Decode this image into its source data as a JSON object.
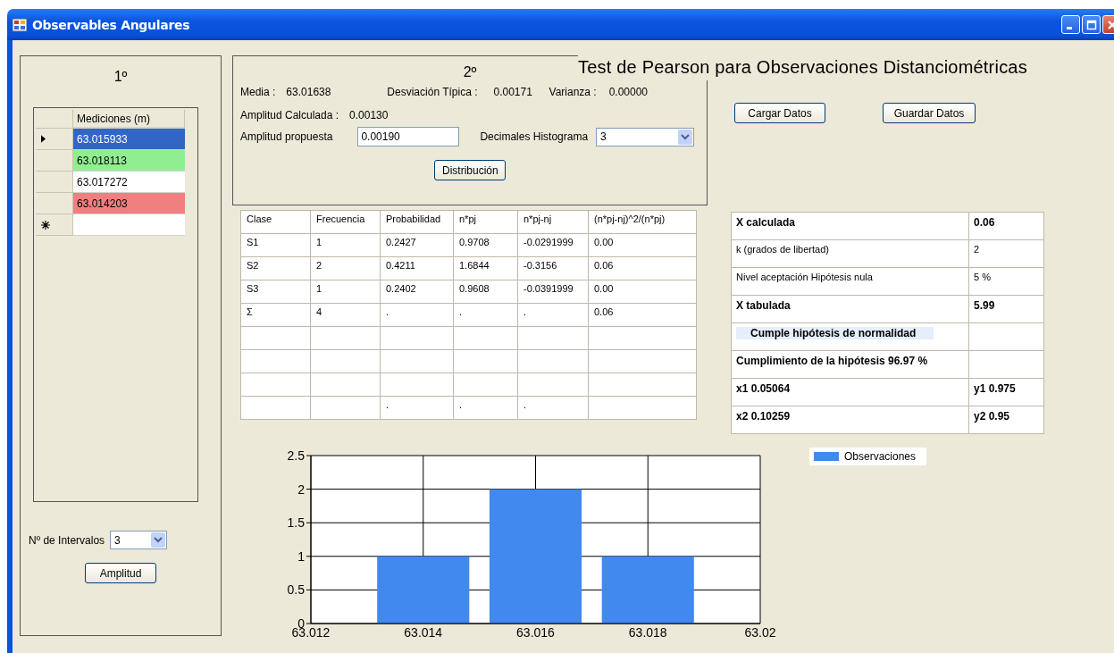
{
  "window": {
    "title": "Observables Angulares"
  },
  "panel_1": {
    "heading": "1º",
    "grid": {
      "column": "Mediciones (m)",
      "rows": [
        {
          "value": "63.015933",
          "selected": true,
          "color": "#3366c4"
        },
        {
          "value": "63.018113",
          "selected": false,
          "color": "#90ee90"
        },
        {
          "value": "63.017272",
          "selected": false,
          "color": "#ffffff"
        },
        {
          "value": "63.014203",
          "selected": false,
          "color": "#f08080"
        }
      ]
    },
    "intervals": {
      "label": "Nº de Intervalos",
      "value": "3"
    },
    "button": "Amplitud"
  },
  "panel_2": {
    "heading": "2º",
    "stats": [
      {
        "label": "Media :",
        "value": "63.01638"
      },
      {
        "label": "Desviación Típica :",
        "value": "0.00171"
      },
      {
        "label": "Varianza :",
        "value": "0.00000"
      }
    ],
    "amplitud_calculada": {
      "label": "Amplitud Calculada :",
      "value": "0.00130"
    },
    "amplitud_propuesta": {
      "label": "Amplitud propuesta",
      "value": "0.00190"
    },
    "decimales": {
      "label": "Decimales Histograma",
      "value": "3"
    },
    "button": "Distribución"
  },
  "title": "Test de Pearson para Observaciones Distanciométricas",
  "buttons": [
    "Cargar Datos",
    "Guardar Datos"
  ],
  "table": {
    "columns": [
      "Clase",
      "Frecuencia",
      "Probabilidad",
      "n*pj",
      "n*pj-nj",
      "(n*pj-nj)^2/(n*pj)"
    ],
    "rows": [
      [
        "S1",
        "1",
        "0.2427",
        "0.9708",
        "-0.0291999",
        "0.00"
      ],
      [
        "S2",
        "2",
        "0.4211",
        "1.6844",
        "-0.3156",
        "0.06"
      ],
      [
        "S3",
        "1",
        "0.2402",
        "0.9608",
        "-0.0391999",
        "0.00"
      ],
      [
        "Σ",
        "4",
        ".",
        ".",
        ".",
        "0.06"
      ],
      [
        null,
        null,
        null,
        null,
        null,
        null
      ],
      [
        null,
        null,
        null,
        null,
        null,
        null
      ],
      [
        null,
        null,
        null,
        null,
        null,
        null
      ],
      [
        null,
        null,
        ".",
        ".",
        ".",
        null
      ]
    ]
  },
  "results": [
    {
      "label": "X calculada",
      "value": "0.06",
      "bold": true,
      "highlight": false
    },
    {
      "label": "k (grados de libertad)",
      "value": "2",
      "bold": false,
      "highlight": false
    },
    {
      "label": "Nivel aceptación Hipótesis nula",
      "value": "5 %",
      "bold": false,
      "highlight": false
    },
    {
      "label": "X tabulada",
      "value": "5.99",
      "bold": true,
      "highlight": false
    },
    {
      "label": "Cumple hipótesis de normalidad",
      "bold": true,
      "highlight": true
    },
    {
      "label": "Cumplimiento de la hipótesis 96.97 %",
      "bold": true,
      "highlight": false
    },
    {
      "label": "x1 0.05064",
      "value": "y1 0.975",
      "bold": true,
      "highlight": false
    },
    {
      "label": "x2 0.10259",
      "value": "y2 0.95",
      "bold": true,
      "highlight": false
    }
  ],
  "chart_data": {
    "type": "bar",
    "x": [
      63.014,
      63.016,
      63.018
    ],
    "series": [
      {
        "name": "Observaciones",
        "color": "#4189ee",
        "values": [
          1,
          2,
          1
        ]
      }
    ],
    "xlim": [
      63.012,
      63.02
    ],
    "ylim": [
      0,
      2.5
    ],
    "grid": true,
    "xticks": [
      {
        "value": 63.012,
        "label": "63.012"
      },
      {
        "value": 63.014,
        "label": "63.014"
      },
      {
        "value": 63.016,
        "label": "63.016"
      },
      {
        "value": 63.018,
        "label": "63.018"
      },
      {
        "value": 63.02,
        "label": "63.02"
      }
    ],
    "yticks": [
      {
        "value": 0,
        "label": "0"
      },
      {
        "value": 0.5,
        "label": "0.5"
      },
      {
        "value": 1,
        "label": "1"
      },
      {
        "value": 1.5,
        "label": "1.5"
      },
      {
        "value": 2,
        "label": "2"
      },
      {
        "value": 2.5,
        "label": "2.5"
      }
    ]
  }
}
